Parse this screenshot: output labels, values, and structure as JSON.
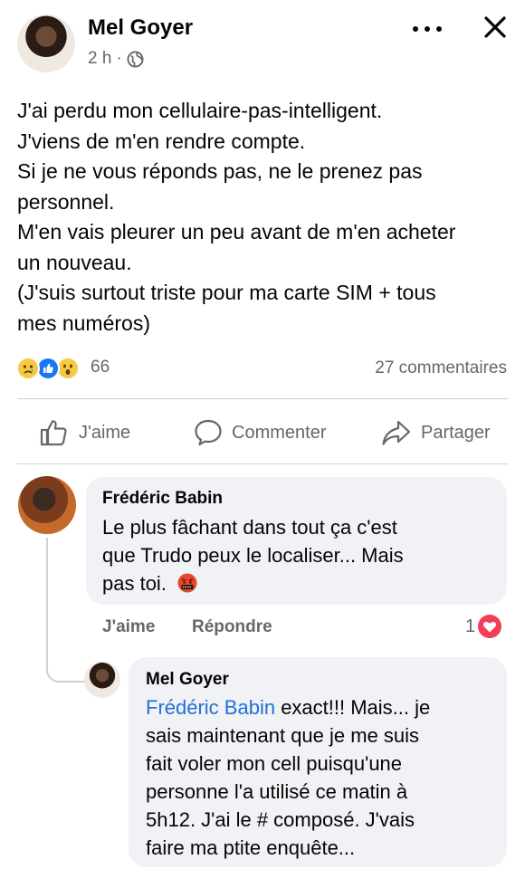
{
  "post": {
    "author": "Mel Goyer",
    "time": "2 h",
    "separator": "·",
    "audience_icon": "globe-icon",
    "lines": [
      "J'ai perdu mon cellulaire-pas-intelligent.",
      "J'viens de m'en rendre compte.",
      "Si je ne vous réponds pas, ne le prenez pas",
      "personnel.",
      "M'en vais pleurer un peu avant de m'en acheter",
      "un nouveau.",
      "(J'suis surtout triste pour ma carte SIM + tous",
      "mes numéros)"
    ],
    "reaction_icons": [
      "sad-reaction-icon",
      "like-reaction-icon",
      "wow-reaction-icon"
    ],
    "reaction_count": "66",
    "comments_count": "27 commentaires"
  },
  "actions": {
    "like": "J'aime",
    "comment": "Commenter",
    "share": "Partager"
  },
  "comments": [
    {
      "author": "Frédéric Babin",
      "lines": [
        "Le plus fâchant dans tout ça c'est",
        "que Trudo peux le localiser... Mais",
        "pas toi."
      ],
      "emoji_icon": "swearing-face-icon",
      "like_label": "J'aime",
      "reply_label": "Répondre",
      "reaction_count": "1",
      "reaction_icon": "love-reaction-icon"
    }
  ],
  "reply": {
    "author": "Mel Goyer",
    "mention": "Frédéric Babin",
    "first_line_rest": " exact!!! Mais... je",
    "lines": [
      "sais maintenant que je me suis",
      "fait voler mon cell puisqu'une",
      "personne l'a utilisé ce matin à",
      "5h12. J'ai le # composé. J'vais",
      "faire ma ptite enquête..."
    ]
  },
  "colors": {
    "text": "#050505",
    "secondary": "#65676b",
    "mention": "#216fdb",
    "bubble": "#f0f2f5",
    "like_blue": "#1877f2",
    "love_red": "#f33e58",
    "emoji_yellow": "#f7c842"
  }
}
